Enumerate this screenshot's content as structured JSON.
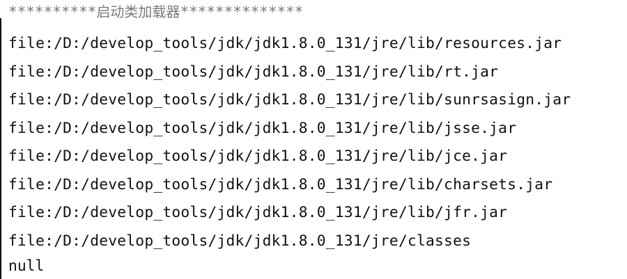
{
  "console": {
    "header": {
      "prefix": "**********",
      "title": "启动类加载器",
      "suffix": "**************"
    },
    "lines": [
      "file:/D:/develop_tools/jdk/jdk1.8.0_131/jre/lib/resources.jar",
      "file:/D:/develop_tools/jdk/jdk1.8.0_131/jre/lib/rt.jar",
      "file:/D:/develop_tools/jdk/jdk1.8.0_131/jre/lib/sunrsasign.jar",
      "file:/D:/develop_tools/jdk/jdk1.8.0_131/jre/lib/jsse.jar",
      "file:/D:/develop_tools/jdk/jdk1.8.0_131/jre/lib/jce.jar",
      "file:/D:/develop_tools/jdk/jdk1.8.0_131/jre/lib/charsets.jar",
      "file:/D:/develop_tools/jdk/jdk1.8.0_131/jre/lib/jfr.jar",
      "file:/D:/develop_tools/jdk/jdk1.8.0_131/jre/classes"
    ],
    "last_line": "null"
  }
}
